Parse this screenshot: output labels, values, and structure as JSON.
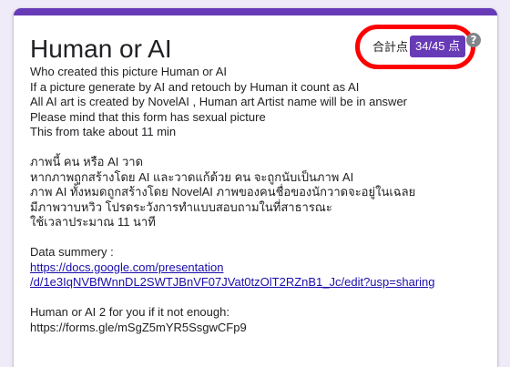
{
  "form": {
    "title": "Human or AI",
    "score": {
      "label": "合計点",
      "value": "34/45 点"
    },
    "help_icon": "?",
    "description": {
      "para1": [
        "Who created this picture  Human or AI",
        "If a picture generate by AI and retouch by Human it count as AI",
        "All AI art is created by NovelAI , Human art Artist name will be in answer",
        "Please mind that this form has sexual picture",
        "This from take about 11 min"
      ],
      "para2": [
        "ภาพนี้ คน หรือ AI วาด",
        "หากภาพถูกสร้างโดย AI และวาดแก้ด้วย คน จะถูกนับเป็นภาพ AI",
        "ภาพ AI ทั้งหมดถูกสร้างโดย  NovelAI ภาพของคนชื่อของนักวาดจะอยู่ในเฉลย",
        "มีภาพวาบหวิว โปรดระวังการทำแบบสอบถามในที่สาธารณะ",
        "ใช้เวลาประมาณ 11 นาที"
      ],
      "data_summary_label": "Data summery :",
      "data_summary_link_line1": "https://docs.google.com/presentation",
      "data_summary_link_line2": "/d/1e3IqNVBfWnnDL2SWTJBnVF07JVat0tzOlT2RZnB1_Jc/edit?usp=sharing",
      "part2_label": "Human or AI 2 for you if it not enough:",
      "part2_link": "https://forms.gle/mSgZ5mYR5SsgwCFp9"
    }
  },
  "colors": {
    "accent": "#673ab7",
    "highlight_circle": "#ff0000",
    "link": "#1a0dab",
    "background": "#f0ebf8"
  }
}
